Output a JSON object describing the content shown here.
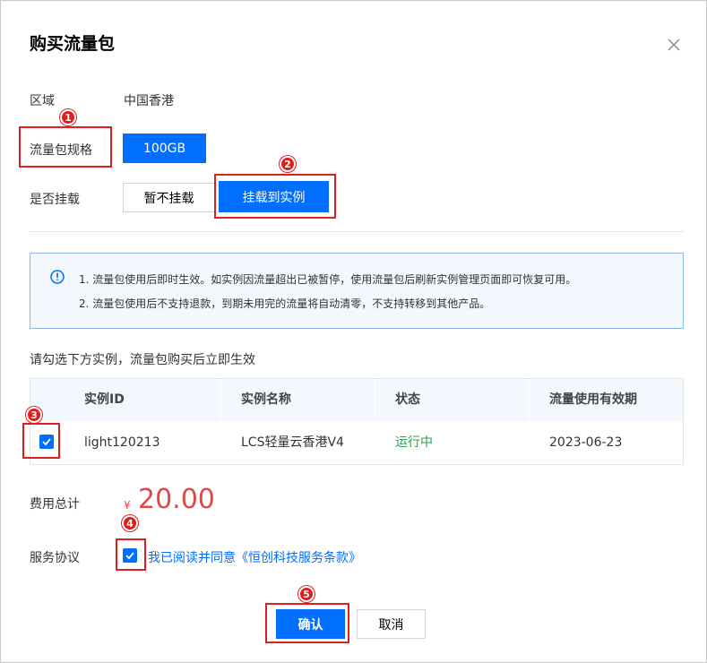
{
  "dialog": {
    "title": "购买流量包",
    "close_icon": "close-icon"
  },
  "form": {
    "region_label": "区域",
    "region_value": "中国香港",
    "spec_label": "流量包规格",
    "spec_option": "100GB",
    "mount_label": "是否挂载",
    "mount_options": [
      "暂不挂载",
      "挂载到实例"
    ],
    "mount_selected": "挂载到实例"
  },
  "notice": {
    "icon": "info-icon",
    "lines": [
      "1. 流量包使用后即时生效。如实例因流量超出已被暂停，使用流量包后刷新实例管理页面即可恢复可用。",
      "2. 流量包使用后不支持退款，到期未用完的流量将自动清零，不支持转移到其他产品。"
    ]
  },
  "hint": "请勾选下方实例，流量包购买后立即生效",
  "table": {
    "columns": [
      "实例ID",
      "实例名称",
      "状态",
      "流量使用有效期"
    ],
    "rows": [
      {
        "checked": true,
        "id": "light120213",
        "name": "LCS轻量云香港V4",
        "status": "运行中",
        "expiry": "2023-06-23"
      }
    ]
  },
  "cost": {
    "label": "费用总计",
    "currency": "¥",
    "amount": "20.00"
  },
  "agreement": {
    "label": "服务协议",
    "checked": true,
    "text": "我已阅读并同意《恒创科技服务条款》"
  },
  "footer": {
    "confirm": "确认",
    "cancel": "取消"
  },
  "markers": [
    "1",
    "2",
    "3",
    "4",
    "5"
  ],
  "colors": {
    "primary": "#006eff",
    "annotation_red": "#e01e1e",
    "price_red": "#e54545",
    "status_green": "#29a04a"
  }
}
